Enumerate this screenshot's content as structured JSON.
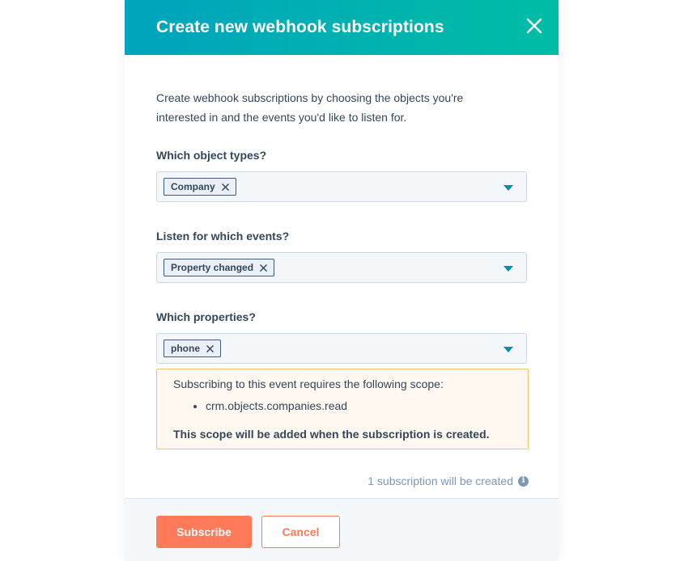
{
  "modal": {
    "title": "Create new webhook subscriptions",
    "close_icon": "close-icon",
    "description": "Create webhook subscriptions by choosing the objects you're interested in and the events you'd like to listen for."
  },
  "fields": [
    {
      "label": "Which object types?",
      "selected_chip": "Company"
    },
    {
      "label": "Listen for which events?",
      "selected_chip": "Property changed"
    },
    {
      "label": "Which properties?",
      "selected_chip": "phone"
    }
  ],
  "scope_alert": {
    "intro": "Subscribing to this event requires the following scope:",
    "scopes": [
      "crm.objects.companies.read"
    ],
    "note": "This scope will be added when the subscription is created."
  },
  "summary": {
    "count_text": "1 subscription will be created",
    "info_icon": "info-icon"
  },
  "footer": {
    "subscribe_label": "Subscribe",
    "cancel_label": "Cancel"
  },
  "colors": {
    "header_gradient_start": "#00a4bd",
    "header_gradient_end": "#00bda5",
    "primary_button": "#ff7a59",
    "caret": "#0091ae",
    "alert_background": "#fef8f0",
    "alert_border": "#f5c26b"
  }
}
